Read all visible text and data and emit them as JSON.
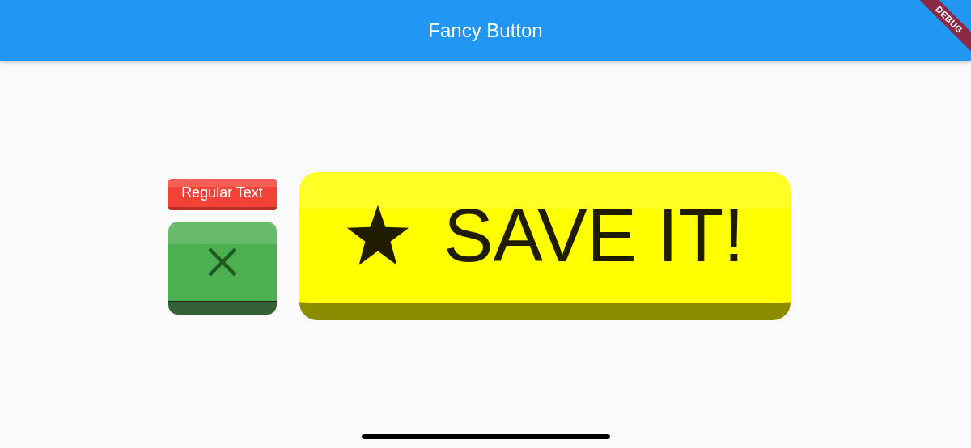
{
  "app_bar": {
    "title": "Fancy Button"
  },
  "debug_banner": {
    "label": "DEBUG"
  },
  "buttons": [
    {
      "kind": "text",
      "label": "Regular Text",
      "color": "#f44336"
    },
    {
      "kind": "close",
      "color": "#4caf50"
    },
    {
      "kind": "star_text",
      "label": "SAVE IT!",
      "color": "#ffff00"
    }
  ]
}
